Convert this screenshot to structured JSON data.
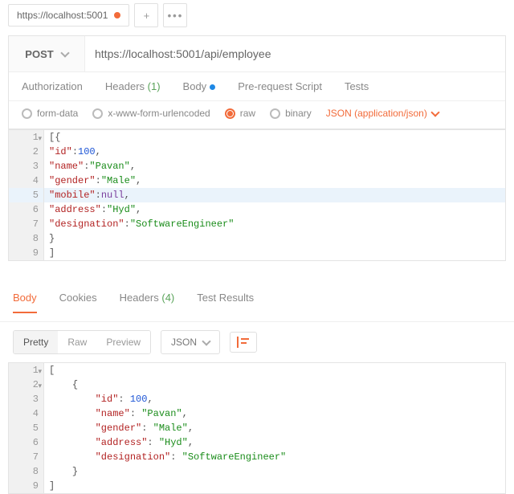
{
  "tabbar": {
    "tab_url": "https://localhost:5001",
    "has_dot": true
  },
  "request": {
    "method": "POST",
    "url": "https://localhost:5001/api/employee",
    "tabs": {
      "auth": "Authorization",
      "headers": "Headers",
      "headers_count": "(1)",
      "body": "Body",
      "prereq": "Pre-request Script",
      "tests": "Tests"
    },
    "body_types": {
      "form": "form-data",
      "urlenc": "x-www-form-urlencoded",
      "raw": "raw",
      "binary": "binary"
    },
    "content_type": "JSON (application/json)"
  },
  "req_editor": [
    {
      "n": "1",
      "fold": true,
      "tokens": [
        {
          "t": "[{",
          "c": "p"
        }
      ]
    },
    {
      "n": "2",
      "tokens": [
        {
          "t": "\"id\"",
          "c": "k"
        },
        {
          "t": ":",
          "c": "p"
        },
        {
          "t": "100",
          "c": "n"
        },
        {
          "t": ",",
          "c": "p"
        }
      ]
    },
    {
      "n": "3",
      "tokens": [
        {
          "t": "\"name\"",
          "c": "k"
        },
        {
          "t": ":",
          "c": "p"
        },
        {
          "t": "\"Pavan\"",
          "c": "s"
        },
        {
          "t": ",",
          "c": "p"
        }
      ]
    },
    {
      "n": "4",
      "tokens": [
        {
          "t": "\"gender\"",
          "c": "k"
        },
        {
          "t": ":",
          "c": "p"
        },
        {
          "t": "\"Male\"",
          "c": "s"
        },
        {
          "t": ",",
          "c": "p"
        }
      ]
    },
    {
      "n": "5",
      "hl": true,
      "tokens": [
        {
          "t": "\"mobile\"",
          "c": "k"
        },
        {
          "t": ":",
          "c": "p"
        },
        {
          "t": "null",
          "c": "nl"
        },
        {
          "t": ",",
          "c": "p"
        }
      ]
    },
    {
      "n": "6",
      "tokens": [
        {
          "t": "\"address\"",
          "c": "k"
        },
        {
          "t": ":",
          "c": "p"
        },
        {
          "t": "\"Hyd\"",
          "c": "s"
        },
        {
          "t": ",",
          "c": "p"
        }
      ]
    },
    {
      "n": "7",
      "tokens": [
        {
          "t": "\"designation\"",
          "c": "k"
        },
        {
          "t": ":",
          "c": "p"
        },
        {
          "t": "\"SoftwareEngineer\"",
          "c": "s"
        }
      ]
    },
    {
      "n": "8",
      "tokens": [
        {
          "t": "}",
          "c": "p"
        }
      ]
    },
    {
      "n": "9",
      "tokens": [
        {
          "t": "]",
          "c": "p"
        }
      ]
    }
  ],
  "response": {
    "tabs": {
      "body": "Body",
      "cookies": "Cookies",
      "headers": "Headers",
      "headers_count": "(4)",
      "results": "Test Results"
    },
    "views": {
      "pretty": "Pretty",
      "raw": "Raw",
      "preview": "Preview"
    },
    "format": "JSON"
  },
  "resp_editor": [
    {
      "n": "1",
      "fold": true,
      "indent": 0,
      "tokens": [
        {
          "t": "[",
          "c": "p"
        }
      ]
    },
    {
      "n": "2",
      "fold": true,
      "indent": 1,
      "tokens": [
        {
          "t": "{",
          "c": "p"
        }
      ]
    },
    {
      "n": "3",
      "indent": 2,
      "tokens": [
        {
          "t": "\"id\"",
          "c": "k"
        },
        {
          "t": ": ",
          "c": "p"
        },
        {
          "t": "100",
          "c": "n"
        },
        {
          "t": ",",
          "c": "p"
        }
      ]
    },
    {
      "n": "4",
      "indent": 2,
      "tokens": [
        {
          "t": "\"name\"",
          "c": "k"
        },
        {
          "t": ": ",
          "c": "p"
        },
        {
          "t": "\"Pavan\"",
          "c": "s"
        },
        {
          "t": ",",
          "c": "p"
        }
      ]
    },
    {
      "n": "5",
      "indent": 2,
      "tokens": [
        {
          "t": "\"gender\"",
          "c": "k"
        },
        {
          "t": ": ",
          "c": "p"
        },
        {
          "t": "\"Male\"",
          "c": "s"
        },
        {
          "t": ",",
          "c": "p"
        }
      ]
    },
    {
      "n": "6",
      "indent": 2,
      "tokens": [
        {
          "t": "\"address\"",
          "c": "k"
        },
        {
          "t": ": ",
          "c": "p"
        },
        {
          "t": "\"Hyd\"",
          "c": "s"
        },
        {
          "t": ",",
          "c": "p"
        }
      ]
    },
    {
      "n": "7",
      "indent": 2,
      "tokens": [
        {
          "t": "\"designation\"",
          "c": "k"
        },
        {
          "t": ": ",
          "c": "p"
        },
        {
          "t": "\"SoftwareEngineer\"",
          "c": "s"
        }
      ]
    },
    {
      "n": "8",
      "indent": 1,
      "tokens": [
        {
          "t": "}",
          "c": "p"
        }
      ]
    },
    {
      "n": "9",
      "indent": 0,
      "tokens": [
        {
          "t": "]",
          "c": "p"
        }
      ]
    }
  ],
  "chart_data": {
    "type": "table",
    "title": "Request/Response JSON payloads",
    "request_body": [
      {
        "id": 100,
        "name": "Pavan",
        "gender": "Male",
        "mobile": null,
        "address": "Hyd",
        "designation": "SoftwareEngineer"
      }
    ],
    "response_body": [
      {
        "id": 100,
        "name": "Pavan",
        "gender": "Male",
        "address": "Hyd",
        "designation": "SoftwareEngineer"
      }
    ]
  }
}
